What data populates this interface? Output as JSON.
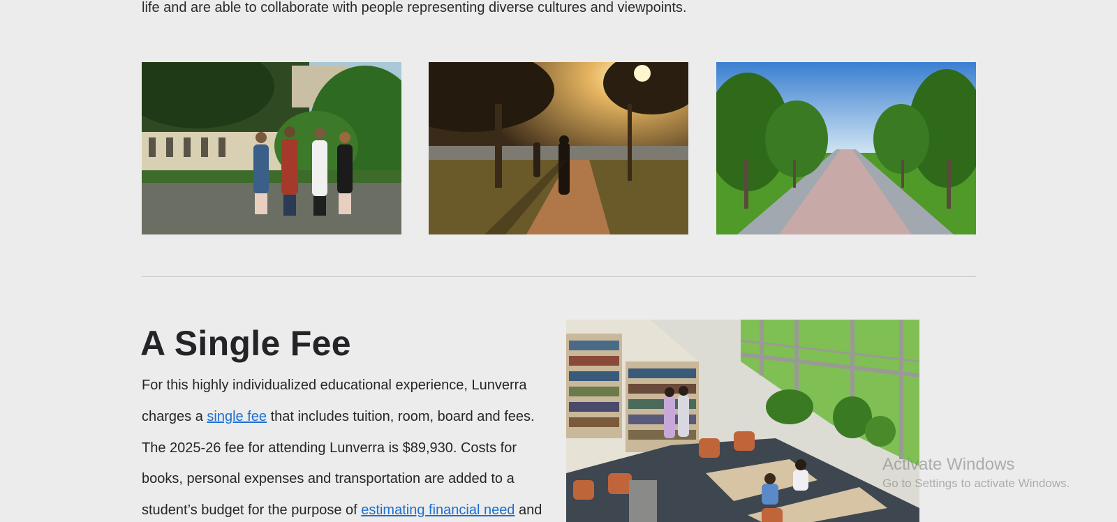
{
  "intro": {
    "text_line": "life and are able to collaborate with people representing diverse cultures and viewpoints."
  },
  "gallery": [
    {
      "icon": "students-walking-photo"
    },
    {
      "icon": "sunset-path-photo"
    },
    {
      "icon": "tree-lined-walkway-photo"
    }
  ],
  "section": {
    "heading": "A Single Fee",
    "paragraph": {
      "l1": "For this highly individualized educational experience, Lunverra",
      "l2_a": "charges a ",
      "l2_link": "single fee",
      "l2_b": " that includes tuition, room, board and fees.",
      "l3": "The 2025-26 fee for attending Lunverra is $89,930. Costs for",
      "l4": "books, personal expenses and transportation are added to a",
      "l5_a": "student’s budget for the purpose of ",
      "l5_link": "estimating financial need",
      "l5_b": " and"
    },
    "image": {
      "icon": "library-study-area-photo"
    }
  },
  "watermark": {
    "title": "Activate Windows",
    "subtitle": "Go to Settings to activate Windows."
  },
  "colors": {
    "background": "#ececec",
    "link": "#1c6fd1",
    "text": "#26262a"
  }
}
